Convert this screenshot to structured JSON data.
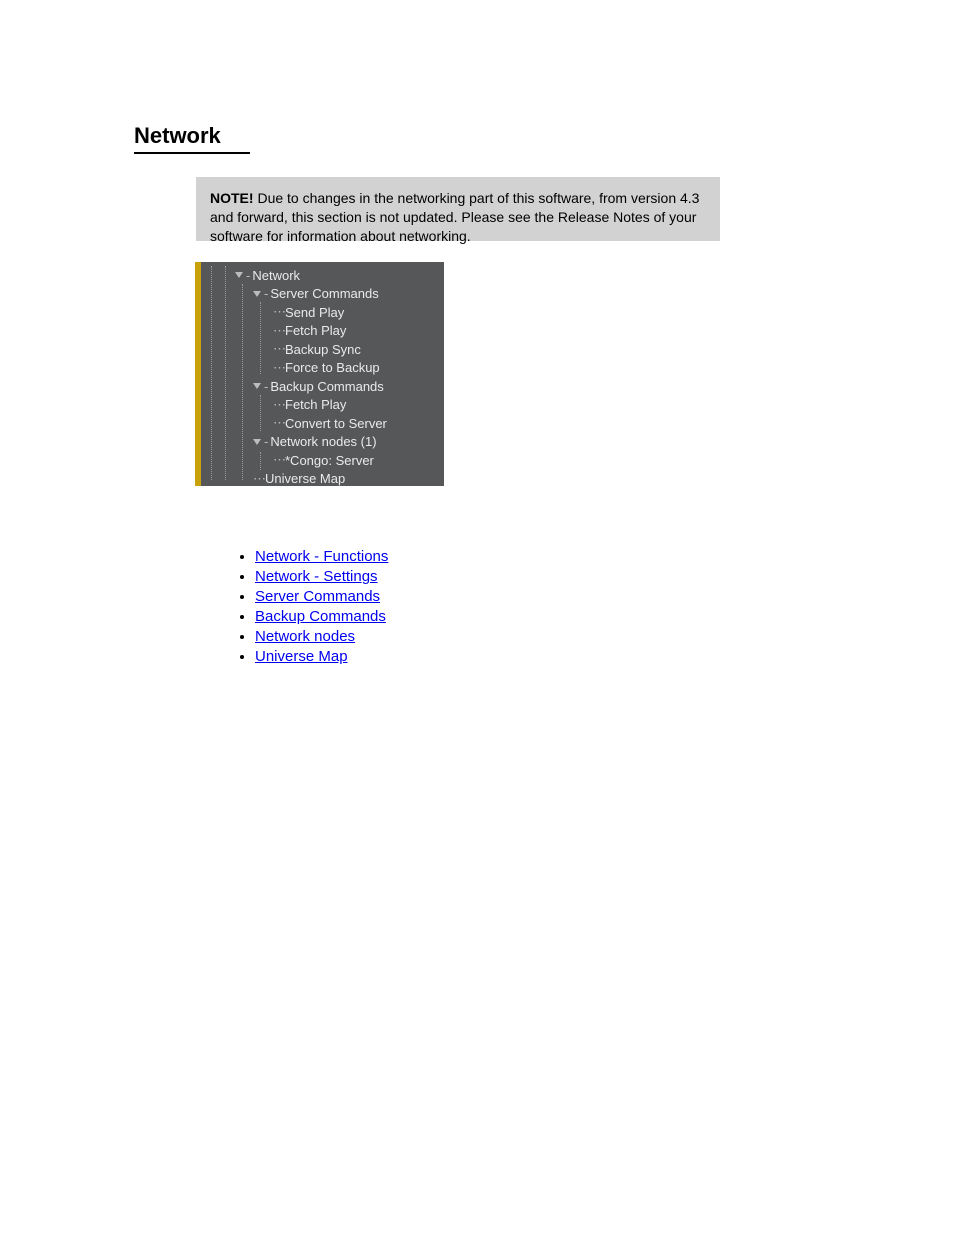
{
  "heading": "Network",
  "note": {
    "label": "NOTE!",
    "body": "Due to changes in the networking part of this software, from version 4.3 and forward, this section is not updated. Please see the Release Notes of your software for information about networking."
  },
  "tree": {
    "root": "Network",
    "server_commands": {
      "label": "Server Commands",
      "items": [
        "Send Play",
        "Fetch Play",
        "Backup Sync",
        "Force to Backup"
      ]
    },
    "backup_commands": {
      "label": "Backup Commands",
      "items": [
        "Fetch Play",
        "Convert to Server"
      ]
    },
    "network_nodes": {
      "label": "Network nodes (1)",
      "items": [
        "*Congo: Server"
      ]
    },
    "universe_map": "Universe Map"
  },
  "links": [
    "Network - Functions",
    "Network - Settings",
    "Server Commands",
    "Backup Commands",
    "Network nodes",
    "Universe Map"
  ]
}
